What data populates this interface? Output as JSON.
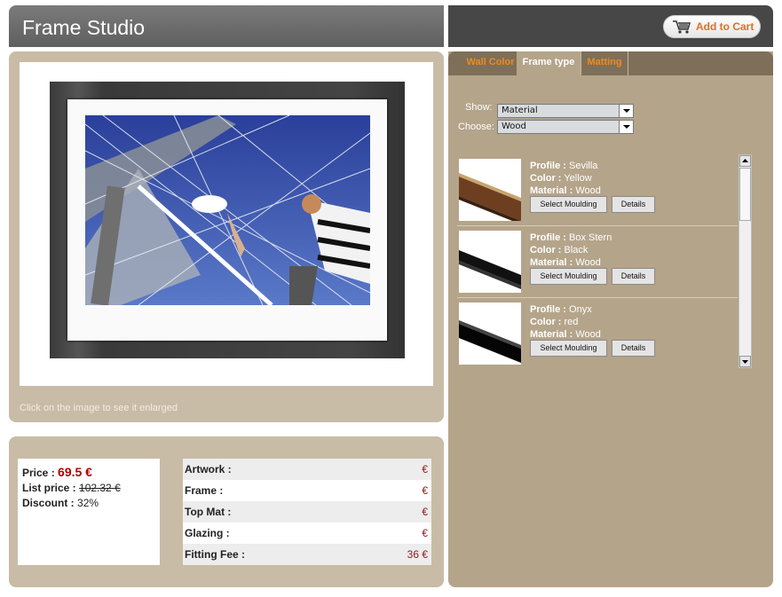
{
  "header": {
    "title": "Frame Studio",
    "cart_label": "Add to Cart"
  },
  "preview": {
    "hint": "Click on the image to see it enlarged"
  },
  "pricing": {
    "price_label": "Price :",
    "price_value": "69.5 €",
    "list_label": "List price :",
    "list_value": "102.32 €",
    "discount_label": "Discount :",
    "discount_value": "32%"
  },
  "costs": [
    {
      "label": "Artwork :",
      "value": "€"
    },
    {
      "label": "Frame :",
      "value": "€"
    },
    {
      "label": "Top Mat :",
      "value": "€"
    },
    {
      "label": "Glazing :",
      "value": "€"
    },
    {
      "label": "Fitting Fee :",
      "value": "36 €"
    }
  ],
  "tabs": [
    {
      "label": "Wall Color"
    },
    {
      "label": "Frame type"
    },
    {
      "label": "Matting"
    }
  ],
  "filters": {
    "show_label": "Show:",
    "show_value": "Material",
    "choose_label": "Choose:",
    "choose_value": "Wood"
  },
  "mouldings": {
    "profile_label": "Profile :",
    "color_label": "Color :",
    "material_label": "Material :",
    "select_label": "Select Moulding",
    "details_label": "Details",
    "items": [
      {
        "profile": "Sevilla",
        "color": "Yellow",
        "material": "Wood",
        "swatch": "#7a4a2a"
      },
      {
        "profile": "Box Stern",
        "color": "Black",
        "material": "Wood",
        "swatch": "#111111"
      },
      {
        "profile": "Onyx",
        "color": "red",
        "material": "Wood",
        "swatch": "#0a0a0a"
      }
    ]
  },
  "colors": {
    "accent": "#e36f1e",
    "price_red": "#b00000",
    "panel_tan": "#c9bca6",
    "right_panel": "#b4a48a"
  }
}
